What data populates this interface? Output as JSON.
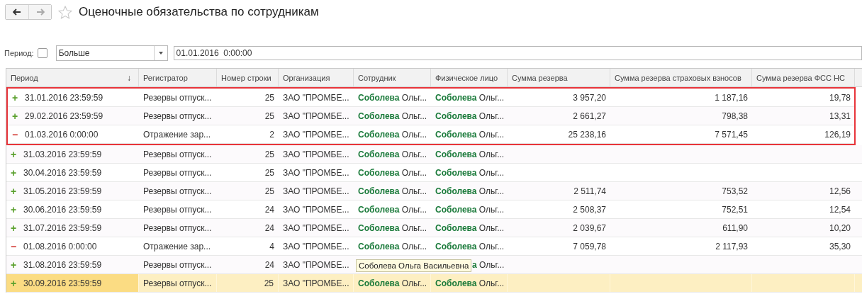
{
  "window": {
    "title": "Оценочные обязательства по сотрудникам",
    "favorite": false
  },
  "filter": {
    "label": "Период:",
    "checked": false,
    "condition": "Больше",
    "value": "01.01.2016  0:00:00"
  },
  "table": {
    "columns": [
      {
        "title": "Период",
        "sort": "↓"
      },
      {
        "title": "Регистратор"
      },
      {
        "title": "Номер строки"
      },
      {
        "title": "Организация"
      },
      {
        "title": "Сотрудник"
      },
      {
        "title": "Физическое лицо"
      },
      {
        "title": "Сумма резерва"
      },
      {
        "title": "Сумма резерва страховых взносов"
      },
      {
        "title": "Сумма резерва ФСС НС"
      }
    ],
    "rows": [
      {
        "sign": "+",
        "kind": "receipt",
        "framed": true,
        "selected": false,
        "cells": [
          "31.01.2016 23:59:59",
          "Резервы отпуск...",
          "25",
          "ЗАО \"ПРОМБЕ...",
          "**Соболева** Ольг...",
          "**Соболева** Ольг...",
          "3 957,20",
          "1 187,16",
          "19,78"
        ]
      },
      {
        "sign": "+",
        "kind": "receipt",
        "framed": true,
        "selected": false,
        "cells": [
          "29.02.2016 23:59:59",
          "Резервы отпуск...",
          "25",
          "ЗАО \"ПРОМБЕ...",
          "**Соболева** Ольг...",
          "**Соболева** Ольг...",
          "2 661,27",
          "798,38",
          "13,31"
        ]
      },
      {
        "sign": "−",
        "kind": "expense",
        "framed": true,
        "selected": false,
        "cells": [
          "01.03.2016 0:00:00",
          "Отражение зар...",
          "2",
          "ЗАО \"ПРОМБЕ...",
          "**Соболева** Ольг...",
          "**Соболева** Ольг...",
          "25 238,16",
          "7 571,45",
          "126,19"
        ]
      },
      {
        "sign": "+",
        "kind": "receipt",
        "framed": false,
        "selected": false,
        "cells": [
          "31.03.2016 23:59:59",
          "Резервы отпуск...",
          "25",
          "ЗАО \"ПРОМБЕ...",
          "**Соболева** Ольг...",
          "**Соболева** Ольг...",
          "",
          "",
          ""
        ]
      },
      {
        "sign": "+",
        "kind": "receipt",
        "framed": false,
        "selected": false,
        "cells": [
          "30.04.2016 23:59:59",
          "Резервы отпуск...",
          "25",
          "ЗАО \"ПРОМБЕ...",
          "**Соболева** Ольг...",
          "**Соболева** Ольг...",
          "",
          "",
          ""
        ]
      },
      {
        "sign": "+",
        "kind": "receipt",
        "framed": false,
        "selected": false,
        "cells": [
          "31.05.2016 23:59:59",
          "Резервы отпуск...",
          "25",
          "ЗАО \"ПРОМБЕ...",
          "**Соболева** Ольг...",
          "**Соболева** Ольг...",
          "2 511,74",
          "753,52",
          "12,56"
        ]
      },
      {
        "sign": "+",
        "kind": "receipt",
        "framed": false,
        "selected": false,
        "cells": [
          "30.06.2016 23:59:59",
          "Резервы отпуск...",
          "24",
          "ЗАО \"ПРОМБЕ...",
          "**Соболева** Ольг...",
          "**Соболева** Ольг...",
          "2 508,37",
          "752,51",
          "12,54"
        ]
      },
      {
        "sign": "+",
        "kind": "receipt",
        "framed": false,
        "selected": false,
        "cells": [
          "31.07.2016 23:59:59",
          "Резервы отпуск...",
          "24",
          "ЗАО \"ПРОМБЕ...",
          "**Соболева** Ольг...",
          "**Соболева** Ольг...",
          "2 039,67",
          "611,90",
          "10,20"
        ]
      },
      {
        "sign": "−",
        "kind": "expense",
        "framed": false,
        "selected": false,
        "cells": [
          "01.08.2016 0:00:00",
          "Отражение зар...",
          "4",
          "ЗАО \"ПРОМБЕ...",
          "**Соболева** Ольг...",
          "**Соболева** Ольг...",
          "7 059,78",
          "2 117,93",
          "35,30"
        ]
      },
      {
        "sign": "+",
        "kind": "receipt",
        "framed": false,
        "selected": false,
        "tooltip": "Соболева Ольга Васильевна",
        "cells": [
          "31.08.2016 23:59:59",
          "Резервы отпуск...",
          "24",
          "ЗАО \"ПРОМБЕ...",
          "",
          "**а** Ольг...",
          "",
          "",
          ""
        ]
      },
      {
        "sign": "+",
        "kind": "receipt",
        "framed": false,
        "selected": true,
        "cells": [
          "30.09.2016 23:59:59",
          "Резервы отпуск...",
          "25",
          "ЗАО \"ПРОМБЕ...",
          "**Соболева** Ольг...",
          "**Соболева** Ольг...",
          "",
          "",
          ""
        ]
      }
    ]
  }
}
